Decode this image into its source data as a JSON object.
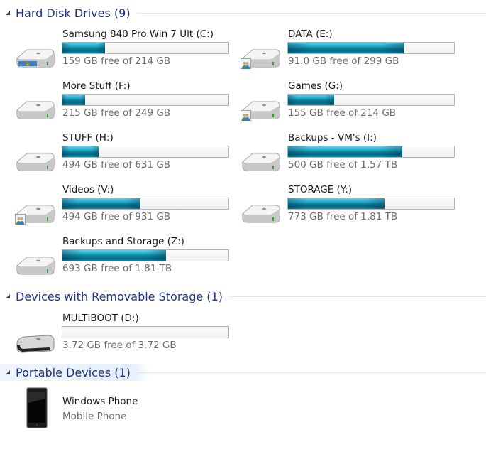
{
  "groups": {
    "hard_disks": {
      "title": "Hard Disk Drives (9)"
    },
    "removable": {
      "title": "Devices with Removable Storage (1)"
    },
    "portable": {
      "title": "Portable Devices (1)"
    }
  },
  "drives": [
    {
      "name": "Samsung 840 Pro Win 7 Ult (C:)",
      "free_text": "159 GB free of 214 GB",
      "used_percent": 25.7,
      "icon": "system-drive-icon",
      "shared": false,
      "windows_logo": true
    },
    {
      "name": "DATA (E:)",
      "free_text": "91.0 GB free of 299 GB",
      "used_percent": 69.6,
      "icon": "shared-drive-icon",
      "shared": true
    },
    {
      "name": "More Stuff (F:)",
      "free_text": "215 GB free of 249 GB",
      "used_percent": 13.7,
      "icon": "hard-drive-icon",
      "shared": false
    },
    {
      "name": "Games (G:)",
      "free_text": "155 GB free of 214 GB",
      "used_percent": 27.6,
      "icon": "shared-drive-icon",
      "shared": true
    },
    {
      "name": "STUFF (H:)",
      "free_text": "494 GB free of 631 GB",
      "used_percent": 21.7,
      "icon": "hard-drive-icon",
      "shared": false
    },
    {
      "name": "Backups - VM's (I:)",
      "free_text": "500 GB free of 1.57 TB",
      "used_percent": 68.9,
      "icon": "hard-drive-icon",
      "shared": false
    },
    {
      "name": "Videos (V:)",
      "free_text": "494 GB free of 931 GB",
      "used_percent": 46.9,
      "icon": "shared-drive-icon",
      "shared": true
    },
    {
      "name": "STORAGE (Y:)",
      "free_text": "773 GB free of 1.81 TB",
      "used_percent": 58.3,
      "icon": "hard-drive-icon",
      "shared": false
    },
    {
      "name": "Backups and Storage (Z:)",
      "free_text": "693 GB free of 1.81 TB",
      "used_percent": 62.6,
      "icon": "hard-drive-icon",
      "shared": false
    }
  ],
  "removable": [
    {
      "name": "MULTIBOOT (D:)",
      "free_text": "3.72 GB free of 3.72 GB",
      "used_percent": 0,
      "icon": "usb-drive-icon"
    }
  ],
  "portable": [
    {
      "name": "Windows Phone",
      "subtitle": "Mobile Phone",
      "icon": "phone-icon"
    }
  ]
}
